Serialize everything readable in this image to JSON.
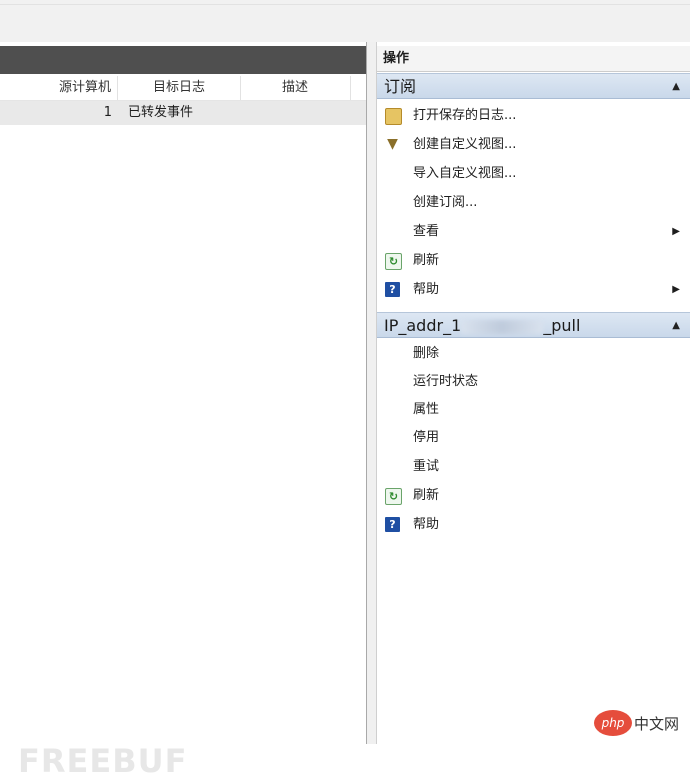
{
  "left_table": {
    "columns": [
      "源计算机",
      "目标日志",
      "描述"
    ],
    "rows": [
      {
        "source_count": "1",
        "target_log": "已转发事件",
        "description": ""
      }
    ]
  },
  "actions": {
    "title": "操作",
    "sections": [
      {
        "title": "订阅",
        "items": [
          {
            "label": "打开保存的日志...",
            "icon": "folder-icon"
          },
          {
            "label": "创建自定义视图...",
            "icon": "filter-icon"
          },
          {
            "label": "导入自定义视图...",
            "icon": ""
          },
          {
            "label": "创建订阅...",
            "icon": ""
          },
          {
            "label": "查看",
            "icon": "",
            "submenu": true
          },
          {
            "label": "刷新",
            "icon": "refresh-icon"
          },
          {
            "label": "帮助",
            "icon": "help-icon",
            "submenu": true
          }
        ]
      },
      {
        "title_prefix": "IP_addr_1",
        "title_suffix": "_pull",
        "items": [
          {
            "label": "删除",
            "icon": ""
          },
          {
            "label": "运行时状态",
            "icon": ""
          },
          {
            "label": "属性",
            "icon": ""
          },
          {
            "label": "停用",
            "icon": ""
          },
          {
            "label": "重试",
            "icon": ""
          },
          {
            "label": "刷新",
            "icon": "refresh-icon"
          },
          {
            "label": "帮助",
            "icon": "help-icon"
          }
        ]
      }
    ]
  },
  "watermark": "FREEBUF",
  "corner_logo": {
    "php": "php",
    "text": "中文网"
  }
}
